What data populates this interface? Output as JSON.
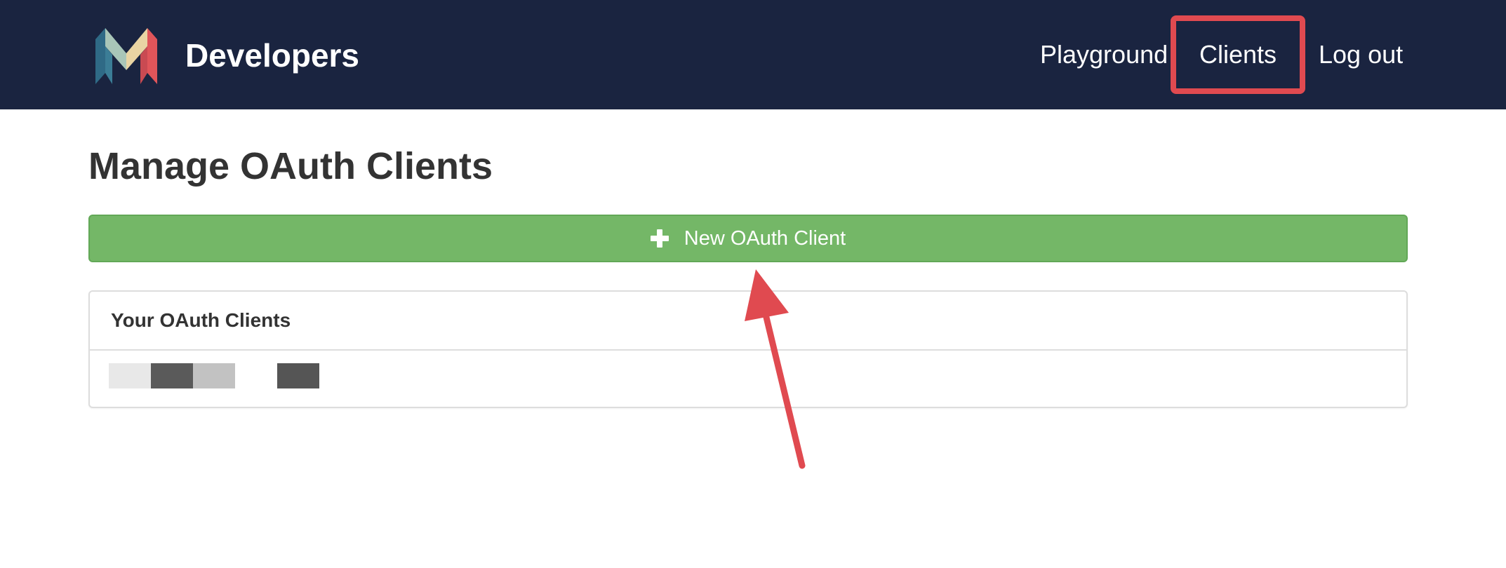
{
  "header": {
    "brand_text": "Developers",
    "logo_icon": "monzo-m-logo-icon",
    "nav": {
      "playground": "Playground",
      "clients": "Clients",
      "logout": "Log out"
    }
  },
  "main": {
    "title": "Manage OAuth Clients",
    "new_client_button": "New OAuth Client",
    "new_client_icon": "plus-icon",
    "clients_panel": {
      "heading": "Your OAuth Clients"
    }
  },
  "annotations": {
    "highlight_color": "#e04a50"
  },
  "colors": {
    "navbar": "#1a2440",
    "button_green": "#74b767",
    "highlight_red": "#e04a50",
    "title_text": "#333333"
  }
}
